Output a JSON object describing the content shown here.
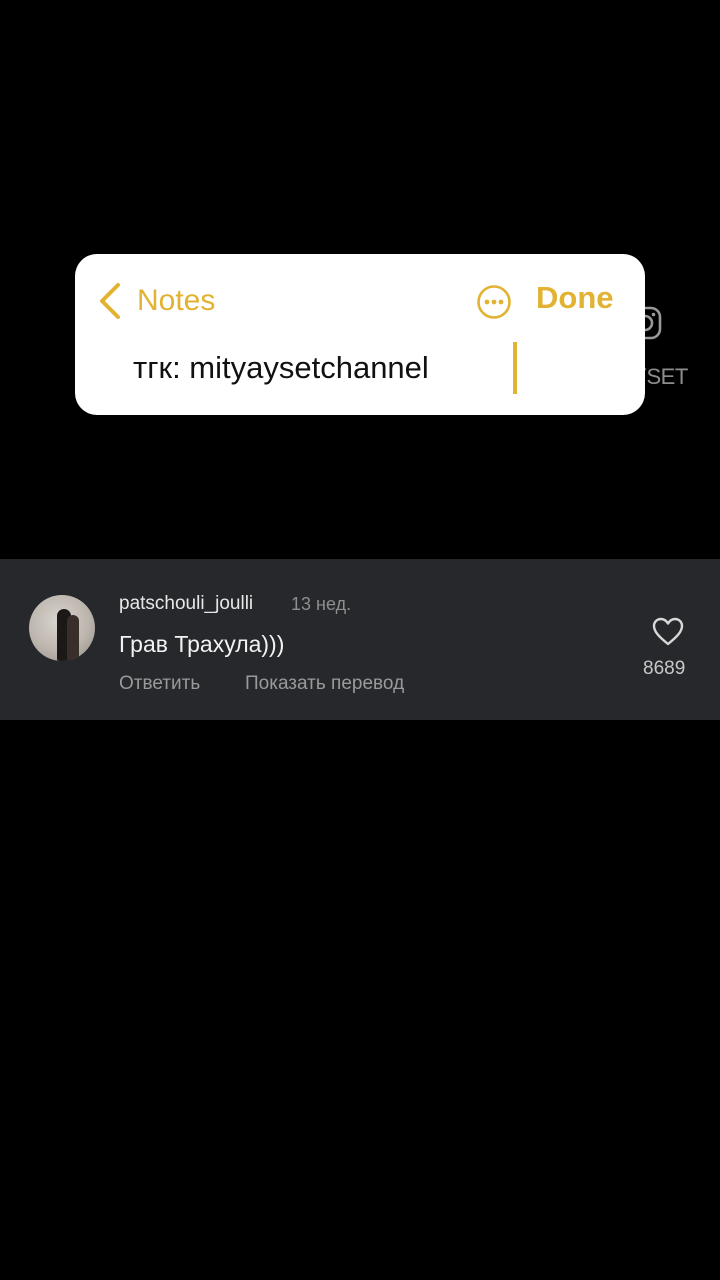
{
  "notes_overlay": {
    "back_label": "Notes",
    "done_label": "Done",
    "note_text": "тгк: mityaysetchannel",
    "accent_color": "#e2b232",
    "icons": [
      "chevron-left-icon",
      "more-circle-icon"
    ]
  },
  "watermark": {
    "handle": "@MITYAYSET",
    "icon": "instagram-icon"
  },
  "comment": {
    "username": "patschouli_joulli",
    "time": "13 нед.",
    "text": "Грав Трахула)))",
    "reply_label": "Ответить",
    "translate_label": "Показать перевод",
    "like_count": "8689",
    "like_icon": "heart-icon"
  }
}
